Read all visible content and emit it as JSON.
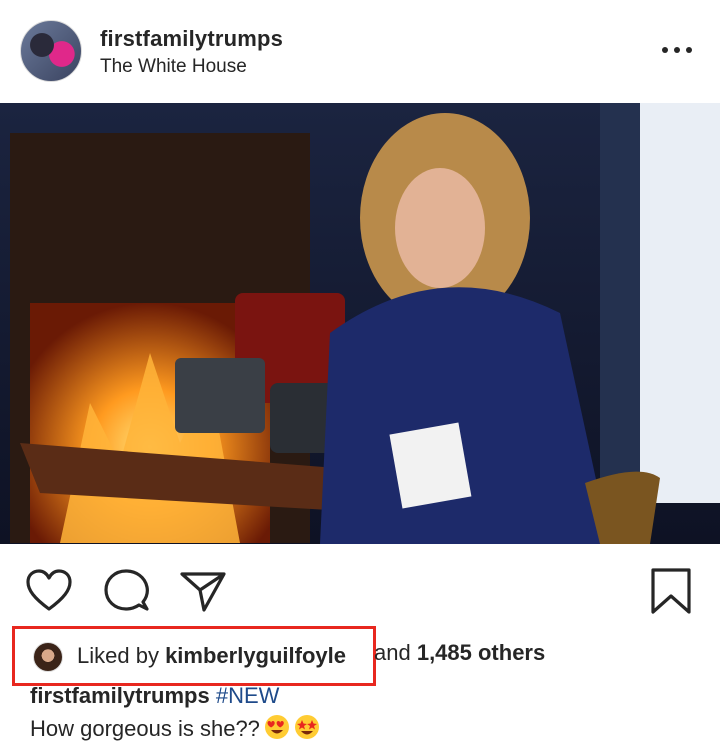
{
  "post": {
    "username": "firstfamilytrumps",
    "location": "The White House"
  },
  "icons": {
    "like": "heart-outline-icon",
    "comment": "speech-bubble-icon",
    "share": "paper-plane-icon",
    "save": "bookmark-icon",
    "more": "three-dots-icon"
  },
  "likes": {
    "prefix": "Liked by ",
    "user": "kimberlyguilfoyle",
    "middle": "and ",
    "count": "1,485 others"
  },
  "caption": {
    "username": "firstfamilytrumps",
    "hashtag": "#NEW",
    "text": "How gorgeous is she??"
  },
  "colors": {
    "highlight_box": "#e8281f",
    "hashtag": "#1e4a8a",
    "text": "#262626"
  }
}
